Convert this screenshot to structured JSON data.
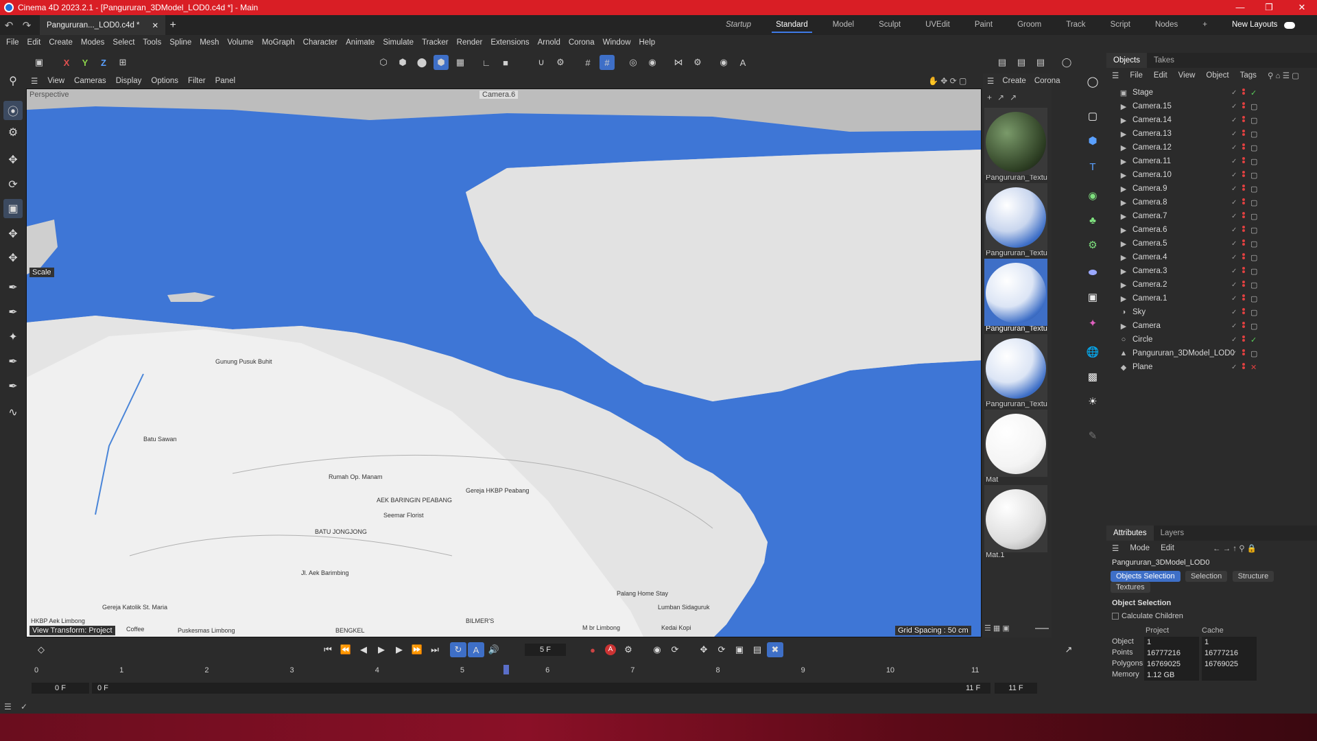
{
  "window": {
    "title": "Cinema 4D 2023.2.1 - [Pangururan_3DModel_LOD0.c4d *] - Main"
  },
  "tab": {
    "doc": "Pangururan..._LOD0.c4d *"
  },
  "layouts": [
    "Startup",
    "Standard",
    "Model",
    "Sculpt",
    "UVEdit",
    "Paint",
    "Groom",
    "Track",
    "Script",
    "Nodes"
  ],
  "layouts_active": "Standard",
  "new_layouts": "New Layouts",
  "menu": [
    "File",
    "Edit",
    "Create",
    "Modes",
    "Select",
    "Tools",
    "Spline",
    "Mesh",
    "Volume",
    "MoGraph",
    "Character",
    "Animate",
    "Simulate",
    "Tracker",
    "Render",
    "Extensions",
    "Arnold",
    "Corona",
    "Window",
    "Help"
  ],
  "axes": {
    "x": "X",
    "y": "Y",
    "z": "Z"
  },
  "viewport_menu": [
    "View",
    "Cameras",
    "Display",
    "Options",
    "Filter",
    "Panel"
  ],
  "viewport": {
    "label": "Perspective",
    "camera": "Camera.6",
    "scale_label": "Scale",
    "grid_spacing": "Grid Spacing : 50 cm",
    "footer": "View Transform: Project",
    "map_labels": [
      "Batu Sawan",
      "Rumah Op. Manam",
      "Gereja HKBP Peabang",
      "AEK BARINGIN PEABANG",
      "BATU JONGJONG",
      "Seemar Florist",
      "Gereja Katolik St. Maria",
      "Lumban Sidaguruk",
      "Palang Home Stay",
      "BILMER'S",
      "M br Limbong",
      "Kedai Kopi",
      "Puskesmas Limbong",
      "HKBP Aek Limbong",
      "Coffee",
      "Gunung Pusuk Buhit",
      "Jl. Aek Barimbing",
      "BENGKEL"
    ]
  },
  "material_menu": {
    "create": "Create",
    "corona": "Corona"
  },
  "materials": [
    {
      "name": "Pangururan_Textu",
      "kind": "terrain"
    },
    {
      "name": "Pangururan_Textu",
      "kind": "blue-white"
    },
    {
      "name": "Pangururan_Textu",
      "kind": "blue-white",
      "selected": true
    },
    {
      "name": "Pangururan_Textu",
      "kind": "blue-white"
    },
    {
      "name": "Mat",
      "kind": "white"
    },
    {
      "name": "Mat.1",
      "kind": "white"
    }
  ],
  "objects_panel": {
    "tabs": [
      "Objects",
      "Takes"
    ],
    "menu": [
      "File",
      "Edit",
      "View",
      "Object",
      "Tags"
    ],
    "items": [
      {
        "name": "Stage",
        "icon": "stage-icon"
      },
      {
        "name": "Camera.15",
        "icon": "camera-icon"
      },
      {
        "name": "Camera.14",
        "icon": "camera-icon"
      },
      {
        "name": "Camera.13",
        "icon": "camera-icon"
      },
      {
        "name": "Camera.12",
        "icon": "camera-icon"
      },
      {
        "name": "Camera.11",
        "icon": "camera-icon"
      },
      {
        "name": "Camera.10",
        "icon": "camera-icon"
      },
      {
        "name": "Camera.9",
        "icon": "camera-icon"
      },
      {
        "name": "Camera.8",
        "icon": "camera-icon"
      },
      {
        "name": "Camera.7",
        "icon": "camera-icon"
      },
      {
        "name": "Camera.6",
        "icon": "camera-icon"
      },
      {
        "name": "Camera.5",
        "icon": "camera-icon"
      },
      {
        "name": "Camera.4",
        "icon": "camera-icon"
      },
      {
        "name": "Camera.3",
        "icon": "camera-icon"
      },
      {
        "name": "Camera.2",
        "icon": "camera-icon"
      },
      {
        "name": "Camera.1",
        "icon": "camera-icon"
      },
      {
        "name": "Sky",
        "icon": "sky-icon"
      },
      {
        "name": "Camera",
        "icon": "camera-icon"
      },
      {
        "name": "Circle",
        "icon": "circle-icon"
      },
      {
        "name": "Pangururan_3DModel_LOD0",
        "icon": "polygon-icon"
      },
      {
        "name": "Plane",
        "icon": "plane-icon"
      }
    ]
  },
  "attributes_panel": {
    "tabs": [
      "Attributes",
      "Layers"
    ],
    "menu": [
      "Mode",
      "Edit"
    ],
    "object_name": "Pangururan_3DModel_LOD0",
    "sub_tabs": [
      "Objects Selection",
      "Selection",
      "Structure",
      "Textures"
    ],
    "section": "Object Selection",
    "calc_children": "Calculate Children",
    "col_project": "Project",
    "col_cache": "Cache",
    "rows": [
      {
        "label": "Object",
        "project": "1",
        "cache": "1"
      },
      {
        "label": "Points",
        "project": "16777216",
        "cache": "16777216"
      },
      {
        "label": "Polygons",
        "project": "16769025",
        "cache": "16769025"
      },
      {
        "label": "Memory",
        "project": "1.12 GB",
        "cache": ""
      }
    ]
  },
  "timeline": {
    "frame_field": "5 F",
    "ticks": [
      "0",
      "1",
      "2",
      "3",
      "4",
      "5",
      "6",
      "7",
      "8",
      "9",
      "10",
      "11"
    ],
    "current_frame": 5,
    "min_frame": 11,
    "start": "0 F",
    "start2": "0 F",
    "end": "11 F",
    "end2": "11 F"
  },
  "colors": {
    "title_red": "#d91e25",
    "accent_blue": "#3e6fc7",
    "water": "#3e76d6",
    "terrain": "#d8d8d8"
  }
}
